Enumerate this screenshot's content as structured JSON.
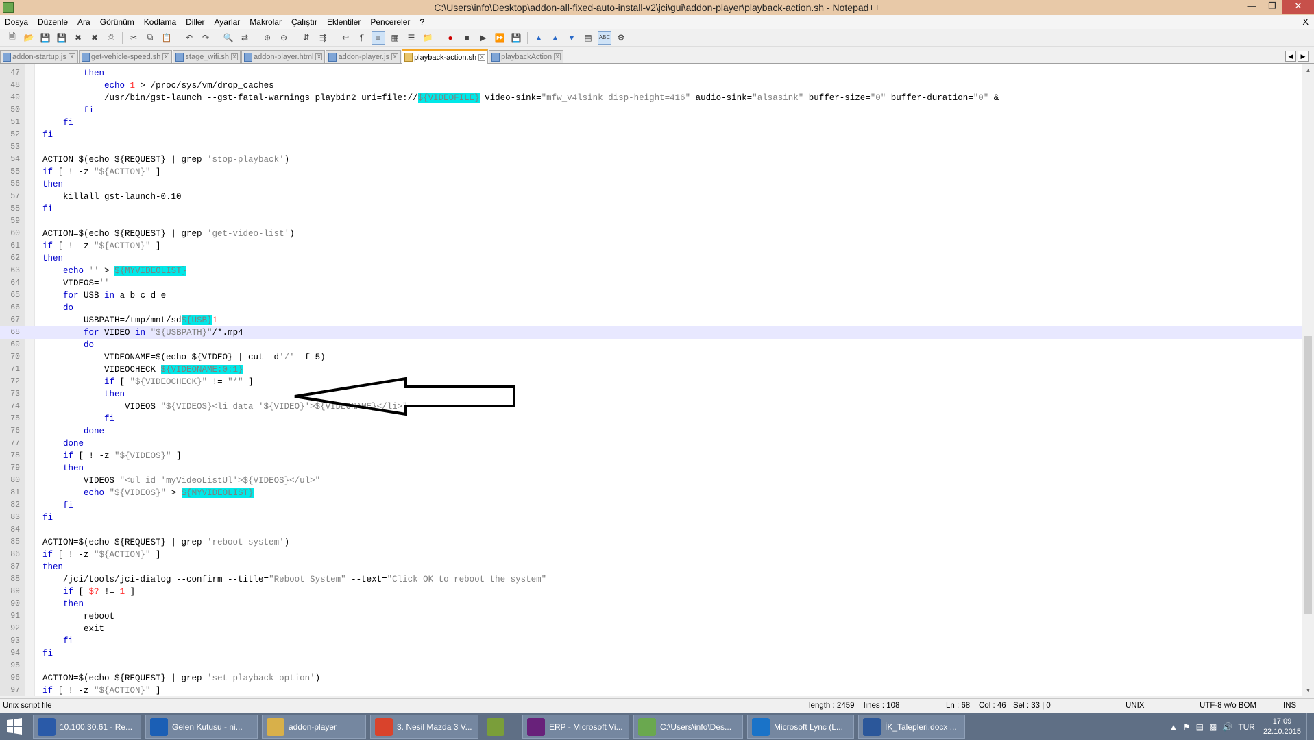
{
  "window": {
    "title": "C:\\Users\\info\\Desktop\\addon-all-fixed-auto-install-v2\\jci\\gui\\addon-player\\playback-action.sh - Notepad++"
  },
  "menu": [
    "Dosya",
    "Düzenle",
    "Ara",
    "Görünüm",
    "Kodlama",
    "Diller",
    "Ayarlar",
    "Makrolar",
    "Çalıştır",
    "Eklentiler",
    "Pencereler",
    "?"
  ],
  "menu_close": "X",
  "tabs": [
    {
      "label": "addon-startup.js",
      "active": false
    },
    {
      "label": "get-vehicle-speed.sh",
      "active": false
    },
    {
      "label": "stage_wifi.sh",
      "active": false
    },
    {
      "label": "addon-player.html",
      "active": false
    },
    {
      "label": "addon-player.js",
      "active": false
    },
    {
      "label": "playback-action.sh",
      "active": true
    },
    {
      "label": "playbackAction",
      "active": false
    }
  ],
  "editor": {
    "current_line": 68,
    "lines": [
      {
        "n": "47",
        "html": "        <span class=\"k\">then</span>"
      },
      {
        "n": "48",
        "html": "            <span class=\"k\">echo</span> <span class=\"n\">1</span> > /proc/sys/vm/drop_caches"
      },
      {
        "n": "49",
        "html": "            /usr/bin/gst-launch --gst-fatal-warnings playbin2 uri=file://<span class=\"hl\">${VIDEOFILE}</span> video-sink=<span class=\"s\">\"mfw_v4lsink disp-height=416\"</span> audio-sink=<span class=\"s\">\"alsasink\"</span> buffer-size=<span class=\"s\">\"0\"</span> buffer-duration=<span class=\"s\">\"0\"</span> &"
      },
      {
        "n": "50",
        "html": "        <span class=\"k\">fi</span>"
      },
      {
        "n": "51",
        "html": "    <span class=\"k\">fi</span>"
      },
      {
        "n": "52",
        "html": "<span class=\"k\">fi</span>"
      },
      {
        "n": "53",
        "html": ""
      },
      {
        "n": "54",
        "html": "ACTION=$(echo ${REQUEST} | grep <span class=\"s\">'stop-playback'</span>)"
      },
      {
        "n": "55",
        "html": "<span class=\"k\">if</span> [ ! -z <span class=\"s\">\"${ACTION}\"</span> ]"
      },
      {
        "n": "56",
        "html": "<span class=\"k\">then</span>"
      },
      {
        "n": "57",
        "html": "    killall gst-launch-0.10"
      },
      {
        "n": "58",
        "html": "<span class=\"k\">fi</span>"
      },
      {
        "n": "59",
        "html": ""
      },
      {
        "n": "60",
        "html": "ACTION=$(echo ${REQUEST} | grep <span class=\"s\">'get-video-list'</span>)"
      },
      {
        "n": "61",
        "html": "<span class=\"k\">if</span> [ ! -z <span class=\"s\">\"${ACTION}\"</span> ]"
      },
      {
        "n": "62",
        "html": "<span class=\"k\">then</span>"
      },
      {
        "n": "63",
        "html": "    <span class=\"k\">echo</span> <span class=\"s\">''</span> > <span class=\"hl\">${MYVIDEOLIST}</span>"
      },
      {
        "n": "64",
        "html": "    VIDEOS=<span class=\"s\">''</span>"
      },
      {
        "n": "65",
        "html": "    <span class=\"k\">for</span> USB <span class=\"k\">in</span> a b c d e"
      },
      {
        "n": "66",
        "html": "    <span class=\"k\">do</span>"
      },
      {
        "n": "67",
        "html": "        USBPATH=/tmp/mnt/sd<span class=\"hl\">${USB}</span><span class=\"n\">1</span>"
      },
      {
        "n": "68",
        "html": "        <span class=\"k\">for</span> VIDEO <span class=\"k\">in</span> <span class=\"s\">\"${USBPATH}\"</span>/*.mp4"
      },
      {
        "n": "69",
        "html": "        <span class=\"k\">do</span>"
      },
      {
        "n": "70",
        "html": "            VIDEONAME=$(echo ${VIDEO} | cut -d<span class=\"s\">'/'</span> -f 5)"
      },
      {
        "n": "71",
        "html": "            VIDEOCHECK=<span class=\"hl\">${VIDEONAME:0:1}</span>"
      },
      {
        "n": "72",
        "html": "            <span class=\"k\">if</span> [ <span class=\"s\">\"${VIDEOCHECK}\"</span> != <span class=\"s\">\"*\"</span> ]"
      },
      {
        "n": "73",
        "html": "            <span class=\"k\">then</span>"
      },
      {
        "n": "74",
        "html": "                VIDEOS=<span class=\"s\">\"${VIDEOS}&lt;li data='${VIDEO}'>${VIDEONAME}&lt;/li>\"</span>"
      },
      {
        "n": "75",
        "html": "            <span class=\"k\">fi</span>"
      },
      {
        "n": "76",
        "html": "        <span class=\"k\">done</span>"
      },
      {
        "n": "77",
        "html": "    <span class=\"k\">done</span>"
      },
      {
        "n": "78",
        "html": "    <span class=\"k\">if</span> [ ! -z <span class=\"s\">\"${VIDEOS}\"</span> ]"
      },
      {
        "n": "79",
        "html": "    <span class=\"k\">then</span>"
      },
      {
        "n": "80",
        "html": "        VIDEOS=<span class=\"s\">\"&lt;ul id='myVideoListUl'>${VIDEOS}&lt;/ul>\"</span>"
      },
      {
        "n": "81",
        "html": "        <span class=\"k\">echo</span> <span class=\"s\">\"${VIDEOS}\"</span> > <span class=\"hl\">${MYVIDEOLIST}</span>"
      },
      {
        "n": "82",
        "html": "    <span class=\"k\">fi</span>"
      },
      {
        "n": "83",
        "html": "<span class=\"k\">fi</span>"
      },
      {
        "n": "84",
        "html": ""
      },
      {
        "n": "85",
        "html": "ACTION=$(echo ${REQUEST} | grep <span class=\"s\">'reboot-system'</span>)"
      },
      {
        "n": "86",
        "html": "<span class=\"k\">if</span> [ ! -z <span class=\"s\">\"${ACTION}\"</span> ]"
      },
      {
        "n": "87",
        "html": "<span class=\"k\">then</span>"
      },
      {
        "n": "88",
        "html": "    /jci/tools/jci-dialog --confirm --title=<span class=\"s\">\"Reboot System\"</span> --text=<span class=\"s\">\"Click OK to reboot the system\"</span>"
      },
      {
        "n": "89",
        "html": "    <span class=\"k\">if</span> [ <span class=\"n\">$?</span> != <span class=\"n\">1</span> ]"
      },
      {
        "n": "90",
        "html": "    <span class=\"k\">then</span>"
      },
      {
        "n": "91",
        "html": "        reboot"
      },
      {
        "n": "92",
        "html": "        exit"
      },
      {
        "n": "93",
        "html": "    <span class=\"k\">fi</span>"
      },
      {
        "n": "94",
        "html": "<span class=\"k\">fi</span>"
      },
      {
        "n": "95",
        "html": ""
      },
      {
        "n": "96",
        "html": "ACTION=$(echo ${REQUEST} | grep <span class=\"s\">'set-playback-option'</span>)"
      },
      {
        "n": "97",
        "html": "<span class=\"k\">if</span> [ ! -z <span class=\"s\">\"${ACTION}\"</span> ]"
      }
    ]
  },
  "status": {
    "filetype": "Unix script file",
    "length": "length : 2459",
    "lines": "lines : 108",
    "ln": "Ln : 68",
    "col": "Col : 46",
    "sel": "Sel : 33 | 0",
    "eol": "UNIX",
    "encoding": "UTF-8 w/o BOM",
    "mode": "INS"
  },
  "taskbar": {
    "items": [
      {
        "label": "10.100.30.61 - Re...",
        "icon": "remote-desktop-icon",
        "color": "#2a5aa8"
      },
      {
        "label": "Gelen Kutusu - ni...",
        "icon": "outlook-icon",
        "color": "#1b5fb5"
      },
      {
        "label": "addon-player",
        "icon": "folder-icon",
        "color": "#d8b04a"
      },
      {
        "label": "3. Nesil Mazda 3 V...",
        "icon": "chrome-icon",
        "color": "#d9432c"
      },
      {
        "label": "",
        "icon": "pinned-app-icon",
        "color": "#7a9e3a"
      },
      {
        "label": "ERP - Microsoft Vi...",
        "icon": "visual-studio-icon",
        "color": "#68217a"
      },
      {
        "label": "C:\\Users\\info\\Des...",
        "icon": "notepadpp-icon",
        "color": "#6aa84f"
      },
      {
        "label": "Microsoft Lync (L...",
        "icon": "lync-icon",
        "color": "#1a73c8"
      },
      {
        "label": "İK_Talepleri.docx ...",
        "icon": "word-icon",
        "color": "#2b579a"
      }
    ],
    "lang": "TUR",
    "time": "17:09",
    "date": "22.10.2015"
  }
}
